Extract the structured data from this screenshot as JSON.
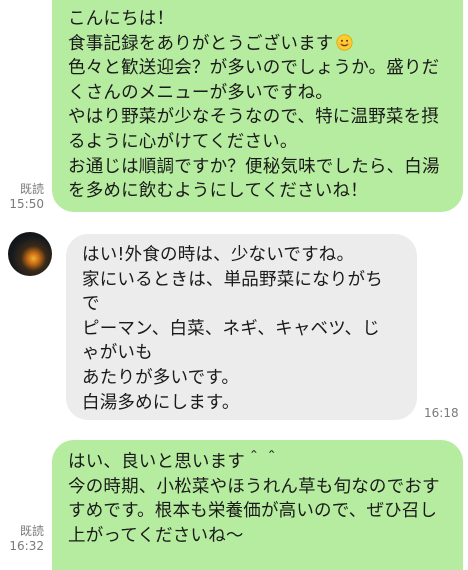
{
  "messages": [
    {
      "direction": "sent",
      "lines": [
        "こんにちは！",
        "食事記録をありがとうございます",
        "色々と歓送迎会？が多いのでしょうか。盛りだ",
        "くさんのメニューが多いですね。",
        "やはり野菜が少なそうなので、特に温野菜を摂",
        "るように心がけてください。",
        "お通じは順調ですか？便秘気味でしたら、白湯",
        "を多めに飲むようにしてくださいね！"
      ],
      "emoji": "smiling-face-emoji",
      "read_label": "既読",
      "time": "15:50"
    },
    {
      "direction": "received",
      "lines": [
        "はい!外食の時は、少ないですね。",
        "家にいるときは、単品野菜になりがち",
        "で",
        "ピーマン、白菜、ネギ、キャベツ、じ",
        "ゃがいも",
        "あたりが多いです。",
        "白湯多めにします。"
      ],
      "avatar": "user-avatar",
      "time": "16:18"
    },
    {
      "direction": "sent",
      "lines": [
        "はい、良いと思います＾＾",
        "今の時期、小松菜やほうれん草も旬なのでおす",
        "すめです。根本も栄養価が高いので、ぜひ召し",
        "上がってくださいね〜"
      ],
      "read_label": "既読",
      "time": "16:32"
    }
  ],
  "colors": {
    "sent_bubble": "#b6ec9f",
    "received_bubble": "#ececec",
    "meta_text": "#7a7a7a"
  }
}
